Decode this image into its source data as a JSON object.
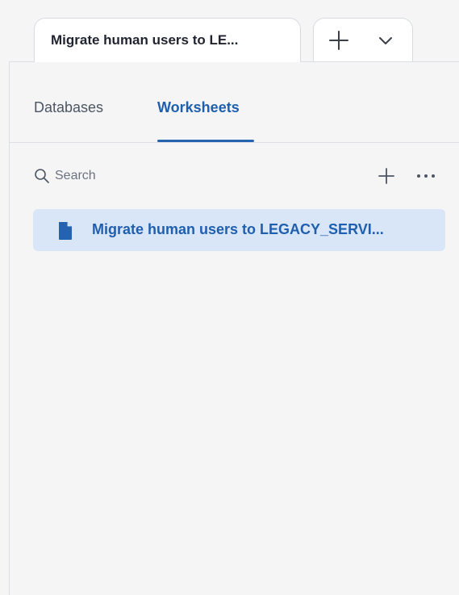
{
  "tabs": {
    "active_title": "Migrate human users to LE...",
    "new_tab_icon": "plus-icon",
    "menu_icon": "chevron-down-icon"
  },
  "nav": {
    "databases": "Databases",
    "worksheets": "Worksheets",
    "active": "Worksheets"
  },
  "search": {
    "placeholder": "Search",
    "value": "",
    "add_icon": "plus-icon",
    "more_icon": "more-horizontal-icon"
  },
  "worksheets": [
    {
      "label": "Migrate human users to LEGACY_SERVI...",
      "icon": "file-icon",
      "selected": true
    }
  ],
  "colors": {
    "accent": "#2563b0",
    "selected_background": "#d8e6f8",
    "panel_background": "#f5f5f6",
    "border": "#dcdfe4"
  }
}
